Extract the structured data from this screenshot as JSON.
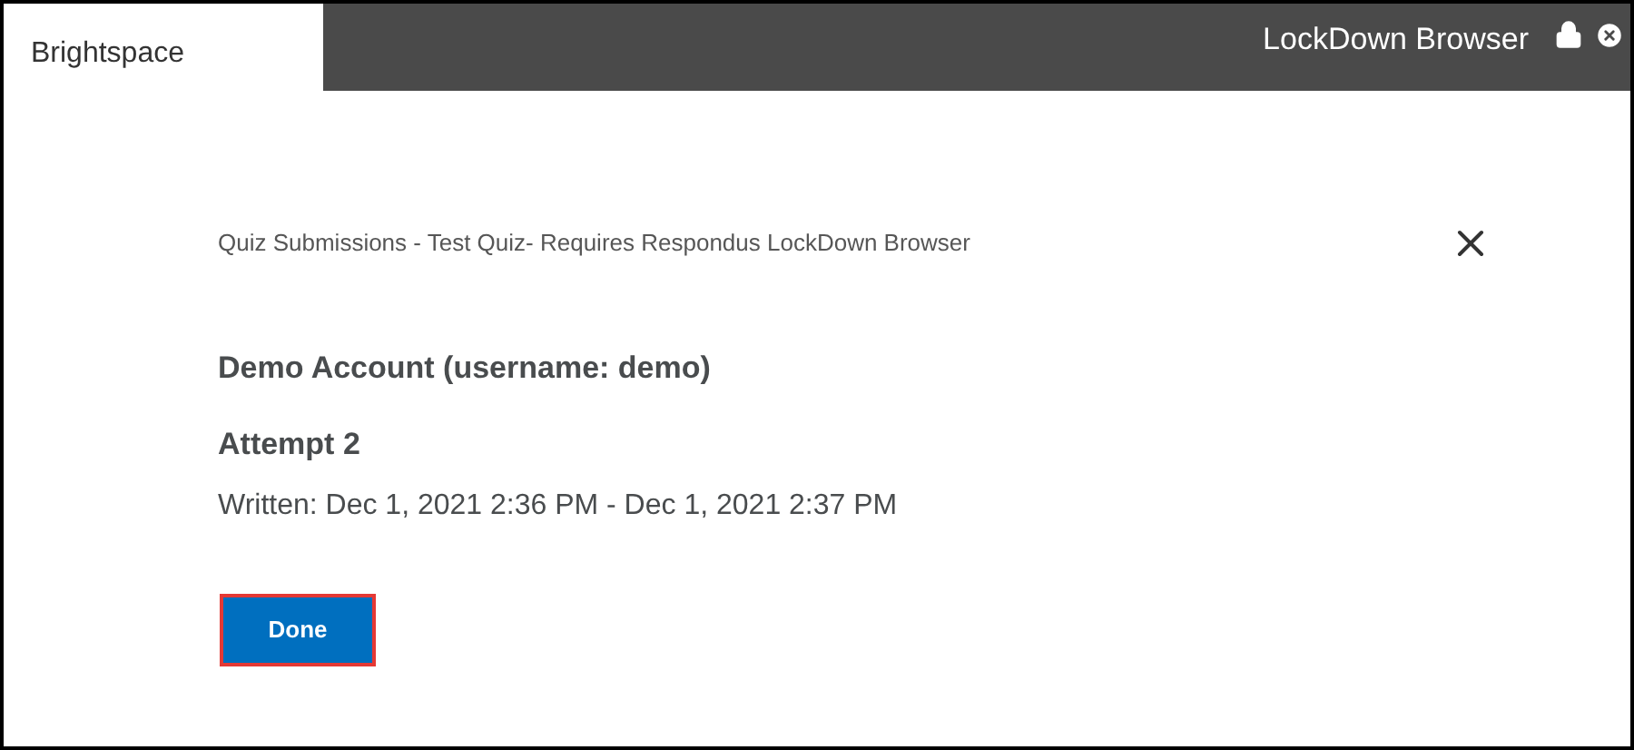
{
  "tabs": [
    {
      "label": "Brightspace",
      "selected": true
    }
  ],
  "app_title": "LockDown Browser",
  "dialog": {
    "title": "Quiz Submissions - Test Quiz- Requires Respondus LockDown Browser",
    "user": "Demo Account (username: demo)",
    "attempt": "Attempt 2",
    "written": "Written: Dec 1, 2021 2:36 PM - Dec 1, 2021 2:37 PM",
    "button": {
      "label": "Done",
      "highlighted": true
    }
  }
}
